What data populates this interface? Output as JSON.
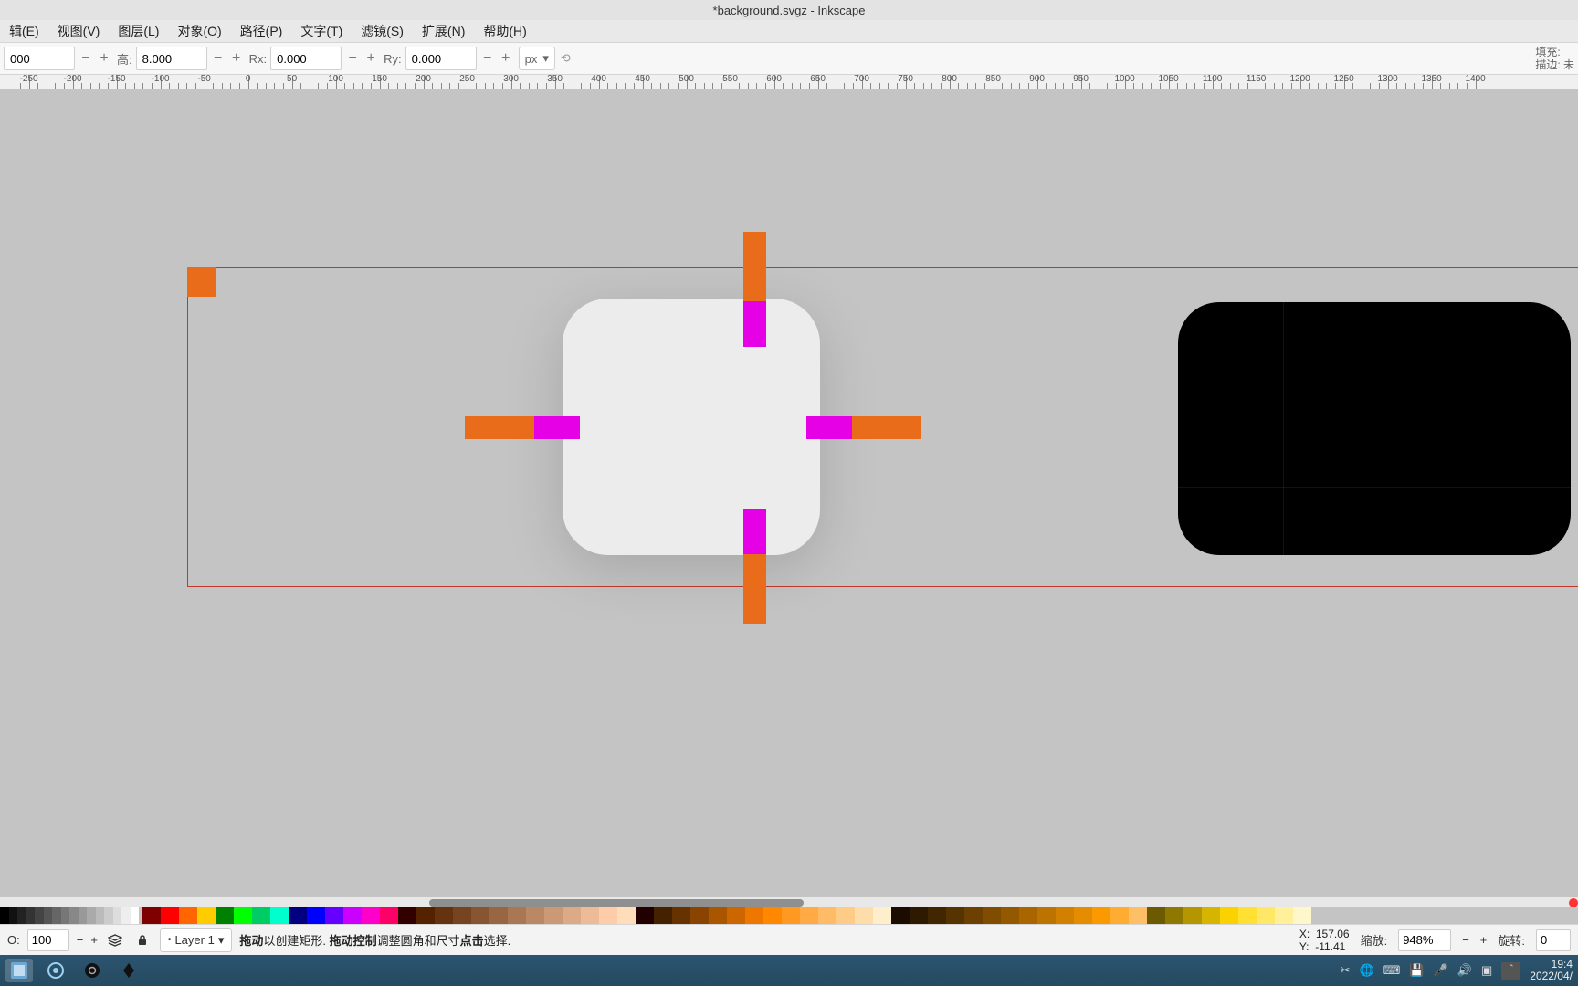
{
  "window": {
    "title": "*background.svgz - Inkscape"
  },
  "menu": {
    "items": [
      "辑(E)",
      "视图(V)",
      "图层(L)",
      "对象(O)",
      "路径(P)",
      "文字(T)",
      "滤镜(S)",
      "扩展(N)",
      "帮助(H)"
    ]
  },
  "toolopts": {
    "w_value": "000",
    "h_label": "高:",
    "h_value": "8.000",
    "rx_label": "Rx:",
    "rx_value": "0.000",
    "ry_label": "Ry:",
    "ry_value": "0.000",
    "unit": "px",
    "fill_label": "填充:",
    "stroke_label": "描边: 未"
  },
  "ruler": {
    "start": -250,
    "end": 1500,
    "major_step": 50,
    "labels": [
      -250,
      -200,
      -150,
      -100,
      -50,
      0,
      50,
      100,
      150,
      200,
      250,
      300,
      350,
      400,
      450,
      500,
      550,
      600,
      650,
      700,
      750,
      800,
      850,
      900,
      950,
      1000,
      1050,
      1100,
      1150,
      1200,
      1250,
      1300,
      1350,
      1400
    ]
  },
  "bottom": {
    "opacity_label": "O:",
    "opacity_value": "100",
    "layer_label": "Layer 1",
    "help_a_bold": "拖动",
    "help_a_rest": "以创建矩形. ",
    "help_b_bold": "拖动控制",
    "help_b_rest": "调整圆角和尺寸",
    "help_c_bold": "点击",
    "help_c_rest": "选择.",
    "x_label": "X:",
    "x_value": "157.06",
    "y_label": "Y:",
    "y_value": "-11.41",
    "zoom_label": "缩放:",
    "zoom_value": "948%",
    "rotate_label": "旋转:",
    "rotate_value": "0"
  },
  "taskbar": {
    "time": "19:4",
    "date": "2022/04/"
  },
  "palette": {
    "grays": [
      "#000000",
      "#111111",
      "#222222",
      "#333333",
      "#444444",
      "#555555",
      "#666666",
      "#777777",
      "#888888",
      "#999999",
      "#aaaaaa",
      "#bbbbbb",
      "#cccccc",
      "#dddddd",
      "#eeeeee",
      "#ffffff"
    ],
    "colors": [
      "#800000",
      "#ff0000",
      "#ff6600",
      "#ffcc00",
      "#008000",
      "#00ff00",
      "#00cc66",
      "#00ffcc",
      "#000080",
      "#0000ff",
      "#6600ff",
      "#cc00ff",
      "#ff00cc",
      "#ff0066",
      "#330000",
      "#552200",
      "#663311",
      "#774422",
      "#885533",
      "#996644",
      "#aa7755",
      "#bb8866",
      "#cc9977",
      "#ddaa88",
      "#eebb99",
      "#ffccaa",
      "#ffddbb",
      "#220000",
      "#442200",
      "#663300",
      "#884400",
      "#aa5500",
      "#cc6600",
      "#ee7700",
      "#ff8800",
      "#ff9922",
      "#ffaa44",
      "#ffbb66",
      "#ffcc88",
      "#ffddaa",
      "#ffeecc",
      "#1a0d00",
      "#2e1a00",
      "#422600",
      "#573300",
      "#6b4000",
      "#804d00",
      "#945900",
      "#a96600",
      "#bd7300",
      "#d18000",
      "#e68c00",
      "#fa9900",
      "#ffac33",
      "#ffbf66",
      "#6b5a00",
      "#8f7800",
      "#b39600",
      "#d6b400",
      "#fad200",
      "#ffe033",
      "#ffe866",
      "#fff099",
      "#fff7cc"
    ]
  }
}
